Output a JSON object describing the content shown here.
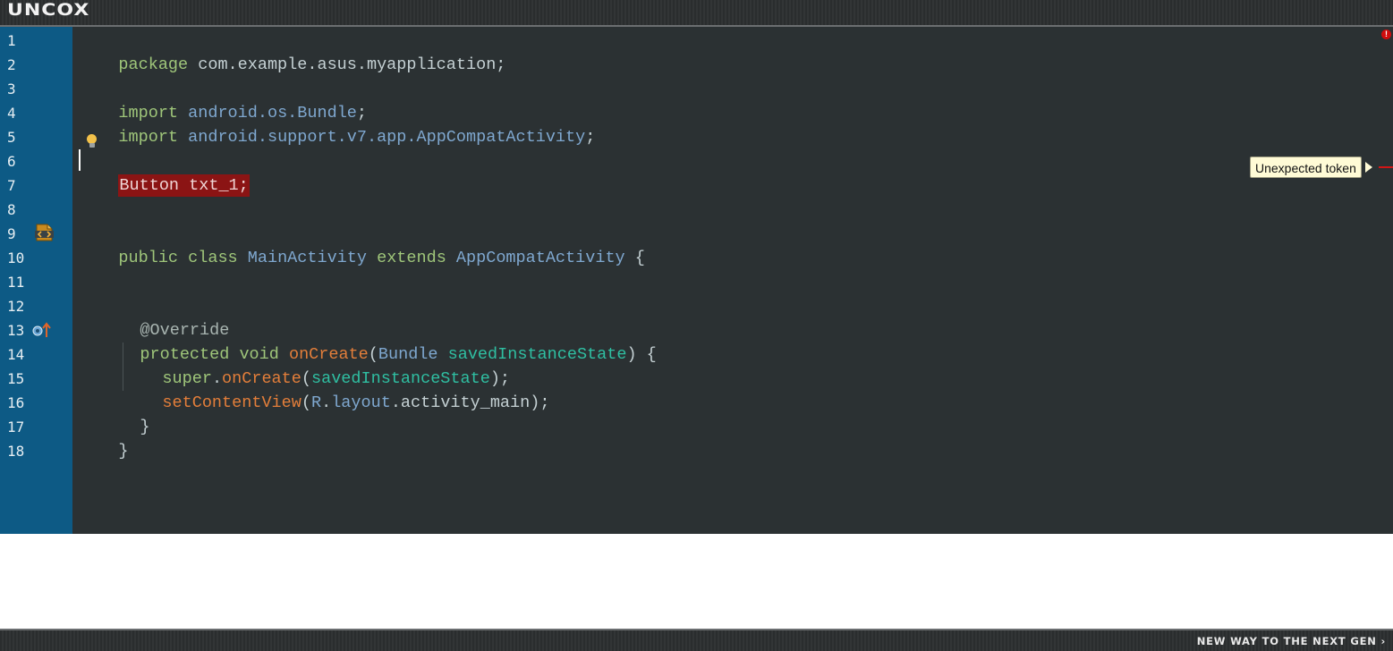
{
  "app": {
    "logo_text": "UNCOX",
    "footer_text": "NEW WAY TO THE NEXT GEN ›"
  },
  "colors": {
    "editor_bg": "#2b3133",
    "gutter_bg": "#0d5a85",
    "error_bg": "#8b1414",
    "keyword": "#9fc67a",
    "class_name": "#7fa8d0",
    "method": "#e37e3a",
    "parameter": "#2fbfa2"
  },
  "gutter": {
    "line_numbers": [
      "1",
      "2",
      "3",
      "4",
      "5",
      "6",
      "7",
      "8",
      "9",
      "10",
      "11",
      "12",
      "13",
      "14",
      "15",
      "16",
      "17",
      "18"
    ],
    "icons": [
      "class-file-icon",
      "override-method-icon",
      "lightbulb-icon"
    ]
  },
  "code": {
    "l1": {
      "kw": "package",
      "rest": " com.example.asus.myapplication;"
    },
    "l3": {
      "kw": "import",
      "pkg": " android.os.",
      "cls": "Bundle",
      "end": ";"
    },
    "l4": {
      "kw": "import",
      "pkg": " android.support.v7.app.",
      "cls": "AppCompatActivity",
      "end": ";"
    },
    "l6": {
      "text": "Button txt_1;"
    },
    "l9": {
      "kw1": "public class",
      "cls1": " MainActivity",
      "kw2": " extends",
      "cls2": " AppCompatActivity",
      "end": " {"
    },
    "l12": {
      "anno": "@Override"
    },
    "l13": {
      "kw": "protected void",
      "meth": " onCreate",
      "p1": "(",
      "cls": "Bundle",
      "param": " savedInstanceState",
      "end": ") {"
    },
    "l14": {
      "kw": "super",
      "dot": ".",
      "meth": "onCreate",
      "p1": "(",
      "param": "savedInstanceState",
      "end": ");"
    },
    "l15": {
      "meth": "setContentView",
      "p1": "(",
      "cls": "R",
      "dot": ".",
      "cls2": "layout",
      "rest": ".activity_main);"
    },
    "l16": {
      "text": "}"
    },
    "l17": {
      "text": "}"
    }
  },
  "diagnostics": {
    "tooltip": "Unexpected token",
    "error_count": "!"
  }
}
